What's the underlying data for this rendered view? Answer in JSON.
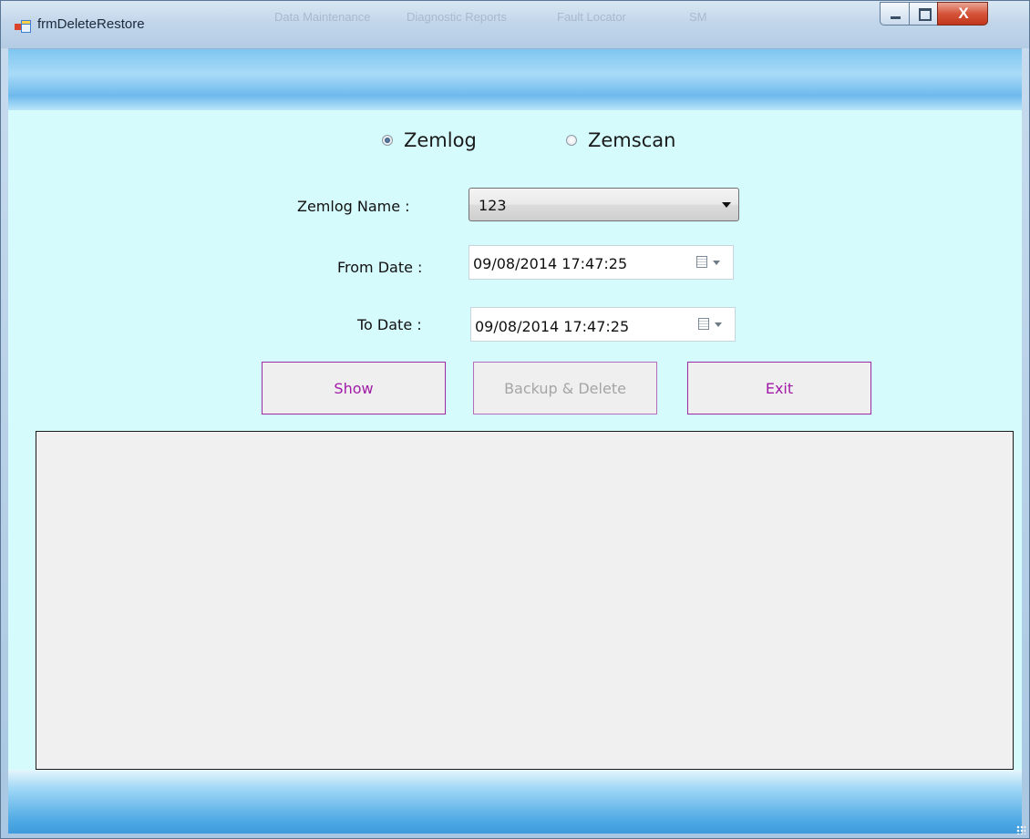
{
  "window": {
    "title": "frmDeleteRestore",
    "background_menu": [
      "Data Maintenance",
      "Diagnostic Reports",
      "Fault Locator",
      "SM"
    ],
    "close_glyph": "X"
  },
  "mode": {
    "options": [
      {
        "label": "Zemlog",
        "checked": true
      },
      {
        "label": "Zemscan",
        "checked": false
      }
    ]
  },
  "form": {
    "zemlog_name_label": "Zemlog Name :",
    "zemlog_name_value": "123",
    "from_date_label": "From Date :",
    "from_date_value": "09/08/2014 17:47:25",
    "to_date_label": "To Date :",
    "to_date_value": "09/08/2014 17:47:25"
  },
  "buttons": {
    "show": "Show",
    "backup_delete": "Backup & Delete",
    "exit": "Exit"
  },
  "colors": {
    "client_bg": "#d6fbfd",
    "button_text": "#a11ba8",
    "button_border": "#9b2aa5",
    "disabled_text": "#a5a5a5"
  }
}
